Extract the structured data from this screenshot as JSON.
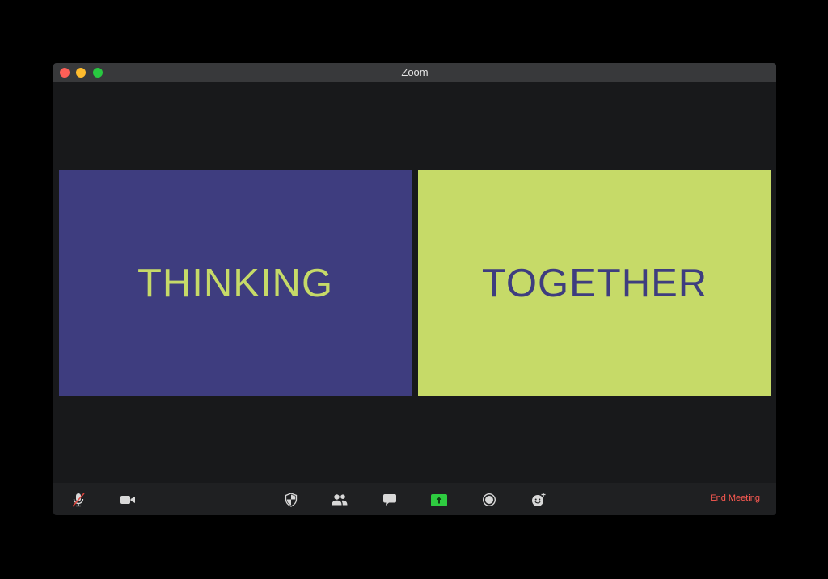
{
  "window": {
    "title": "Zoom"
  },
  "tiles": [
    {
      "text": "THINKING",
      "background": "#3e3d7f",
      "color": "#c6da68"
    },
    {
      "text": "TOGETHER",
      "background": "#c6da68",
      "color": "#3e3d7f"
    }
  ],
  "toolbar": {
    "buttons": [
      {
        "name": "unmute",
        "icon": "microphone-muted-icon"
      },
      {
        "name": "video",
        "icon": "video-camera-icon"
      },
      {
        "name": "security",
        "icon": "shield-icon"
      },
      {
        "name": "participants",
        "icon": "people-icon"
      },
      {
        "name": "chat",
        "icon": "chat-bubble-icon"
      },
      {
        "name": "share-screen",
        "icon": "share-screen-arrow-icon",
        "active": true
      },
      {
        "name": "record",
        "icon": "record-icon"
      },
      {
        "name": "reactions",
        "icon": "emoji-plus-icon"
      }
    ],
    "end_meeting_label": "End Meeting"
  },
  "colors": {
    "window_bg": "#18191b",
    "toolbar_bg": "#1f2022",
    "share_green": "#2ecc40",
    "end_meeting_red": "#ff5a52"
  }
}
